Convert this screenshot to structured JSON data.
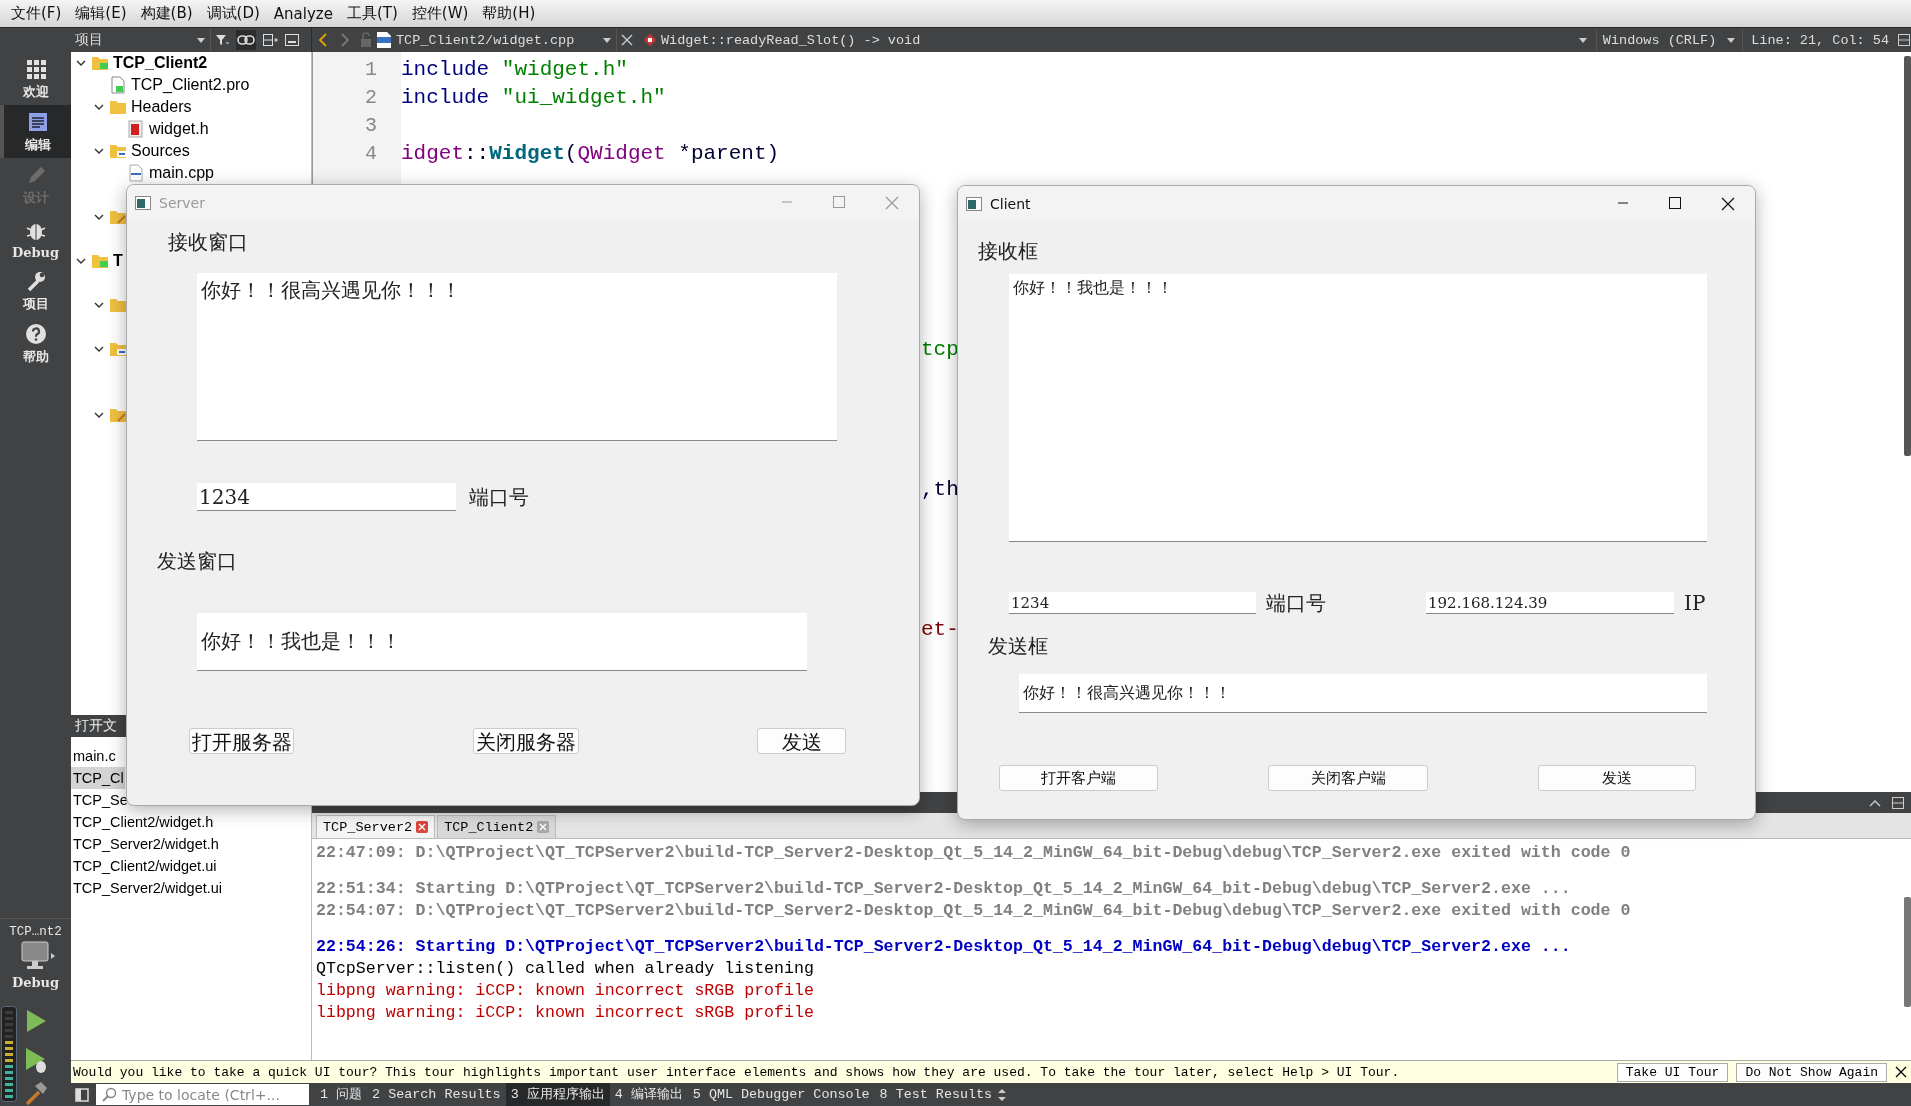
{
  "menu": [
    "文件(F)",
    "编辑(E)",
    "构建(B)",
    "调试(D)",
    "Analyze",
    "工具(T)",
    "控件(W)",
    "帮助(H)"
  ],
  "toolbar": {
    "panel_selector": "项目",
    "file_selector": "TCP_Client2/widget.cpp",
    "symbol": "Widget::readyRead_Slot() -> void",
    "line_endings": "Windows (CRLF)",
    "cursor": "Line: 21, Col: 54"
  },
  "modes": [
    {
      "kind": "welcome",
      "label": "欢迎",
      "selected": false,
      "disabled": false
    },
    {
      "kind": "edit",
      "label": "编辑",
      "selected": true,
      "disabled": false
    },
    {
      "kind": "design",
      "label": "设计",
      "selected": false,
      "disabled": true
    },
    {
      "kind": "debug",
      "label": "Debug",
      "selected": false,
      "disabled": false
    },
    {
      "kind": "projects",
      "label": "项目",
      "selected": false,
      "disabled": false
    },
    {
      "kind": "help",
      "label": "帮助",
      "selected": false,
      "disabled": false
    }
  ],
  "run_target": {
    "project": "TCP…nt2",
    "build": "Debug"
  },
  "project_tree": [
    {
      "kind": "project",
      "label": "TCP_Client2",
      "expanded": true,
      "children": [
        {
          "kind": "profile",
          "label": "TCP_Client2.pro"
        },
        {
          "kind": "headers",
          "label": "Headers",
          "expanded": true,
          "children": [
            {
              "kind": "header",
              "label": "widget.h"
            }
          ]
        },
        {
          "kind": "sources",
          "label": "Sources",
          "expanded": true,
          "children": [
            {
              "kind": "source",
              "label": "main.cpp"
            },
            {
              "kind": "source"
            }
          ]
        },
        {
          "kind": "forms",
          "expanded": true,
          "children": [
            {
              "kind": "form"
            }
          ]
        }
      ]
    },
    {
      "kind": "project",
      "label": "T",
      "expanded": true,
      "children": [
        {
          "kind": "profile"
        },
        {
          "kind": "headers",
          "expanded": true,
          "children": [
            {
              "kind": "header"
            }
          ]
        },
        {
          "kind": "sources",
          "expanded": true,
          "children": [
            {
              "kind": "source"
            },
            {
              "kind": "source"
            }
          ]
        },
        {
          "kind": "forms",
          "expanded": true,
          "children": [
            {
              "kind": "form"
            }
          ]
        }
      ]
    }
  ],
  "open_documents": {
    "title": "打开文",
    "items": [
      {
        "label": "main.c",
        "selected": false
      },
      {
        "label": "TCP_Cl",
        "selected": true
      },
      {
        "label": "TCP_Se",
        "selected": false
      },
      {
        "label": "TCP_Client2/widget.h",
        "selected": false
      },
      {
        "label": "TCP_Server2/widget.h",
        "selected": false
      },
      {
        "label": "TCP_Client2/widget.ui",
        "selected": false
      },
      {
        "label": "TCP_Server2/widget.ui",
        "selected": false
      }
    ]
  },
  "editor": {
    "lines": [
      {
        "number": "1",
        "parts": [
          {
            "kind": "preprocessor",
            "text": "include "
          },
          {
            "kind": "string",
            "text": "\"widget.h\""
          }
        ]
      },
      {
        "number": "2",
        "parts": [
          {
            "kind": "preprocessor",
            "text": "include "
          },
          {
            "kind": "string",
            "text": "\"ui_widget.h\""
          }
        ]
      },
      {
        "number": "3"
      },
      {
        "number": "4",
        "parts": [
          {
            "kind": "type",
            "text": "idget"
          },
          {
            "kind": "plain",
            "text": "::"
          },
          {
            "kind": "function",
            "text": "Widget"
          },
          {
            "kind": "plain",
            "text": "("
          },
          {
            "kind": "type",
            "text": "QWidget"
          },
          {
            "kind": "plain",
            "text": " *parent)"
          }
        ]
      }
    ],
    "fragments": [
      {
        "kind": "string",
        "text": "tcp"
      },
      {
        "kind": "plain",
        "text": ",th"
      },
      {
        "kind": "member",
        "text": "et-"
      }
    ]
  },
  "output": {
    "tabs": [
      {
        "label": "TCP_Server2",
        "selected": true
      },
      {
        "label": "TCP_Client2",
        "selected": false
      }
    ],
    "blocks": [
      [
        {
          "kind": "info",
          "text": "22:47:09: D:\\QTProject\\QT_TCPServer2\\build-TCP_Server2-Desktop_Qt_5_14_2_MinGW_64_bit-Debug\\debug\\TCP_Server2.exe exited with code 0"
        }
      ],
      [
        {
          "kind": "info",
          "text": "22:51:34: Starting D:\\QTProject\\QT_TCPServer2\\build-TCP_Server2-Desktop_Qt_5_14_2_MinGW_64_bit-Debug\\debug\\TCP_Server2.exe ..."
        },
        {
          "kind": "info",
          "text": "22:54:07: D:\\QTProject\\QT_TCPServer2\\build-TCP_Server2-Desktop_Qt_5_14_2_MinGW_64_bit-Debug\\debug\\TCP_Server2.exe exited with code 0"
        }
      ],
      [
        {
          "kind": "current",
          "text": "22:54:26: Starting D:\\QTProject\\QT_TCPServer2\\build-TCP_Server2-Desktop_Qt_5_14_2_MinGW_64_bit-Debug\\debug\\TCP_Server2.exe ..."
        },
        {
          "kind": "plain",
          "text": "QTcpServer::listen() called when already listening"
        },
        {
          "kind": "warning",
          "text": "libpng warning: iCCP: known incorrect sRGB profile"
        },
        {
          "kind": "warning",
          "text": "libpng warning: iCCP: known incorrect sRGB profile"
        }
      ]
    ]
  },
  "tour": {
    "text": "Would you like to take a quick UI tour? This tour highlights important user interface elements and shows how they are used. To take the tour later, select Help > UI Tour.",
    "buttons": [
      "Take UI Tour",
      "Do Not Show Again"
    ]
  },
  "status_bar": {
    "locator": {
      "placeholder": "Type to locate (Ctrl+..."
    },
    "panes": [
      {
        "label": "1 问题",
        "selected": false
      },
      {
        "label": "2 Search Results",
        "selected": false
      },
      {
        "label": "3 应用程序输出",
        "selected": true
      },
      {
        "label": "4 编译输出",
        "selected": false
      },
      {
        "label": "5 QML Debugger Console",
        "selected": false
      },
      {
        "label": "8 Test Results",
        "selected": false
      }
    ]
  },
  "windows": [
    {
      "title": "Server",
      "active": false,
      "receive_label": "接收窗口",
      "receive_text": "你好！！很高兴遇见你！！！",
      "port": "1234",
      "port_label": "端口号",
      "send_label": "发送窗口",
      "send_text": "你好！！我也是！！！",
      "buttons": [
        "打开服务器",
        "关闭服务器",
        "发送"
      ]
    },
    {
      "title": "Client",
      "active": true,
      "receive_label": "接收框",
      "receive_text": "你好！！我也是！！！",
      "port": "1234",
      "port_label": "端口号",
      "ip": "192.168.124.39",
      "ip_label": "IP",
      "send_label": "发送框",
      "send_text": "你好！！很高兴遇见你！！！",
      "buttons": [
        "打开客户端",
        "关闭客户端",
        "发送"
      ]
    }
  ]
}
